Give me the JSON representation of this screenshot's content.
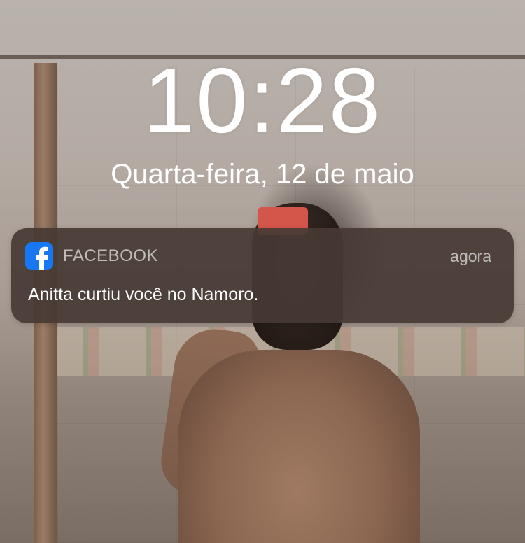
{
  "lock_screen": {
    "time": "10:28",
    "date": "Quarta-feira, 12 de maio"
  },
  "notification": {
    "app_icon": "facebook-icon",
    "app_name": "FACEBOOK",
    "timestamp": "agora",
    "message": "Anitta curtiu você no Namoro.",
    "brand_color": "#1877f2"
  }
}
